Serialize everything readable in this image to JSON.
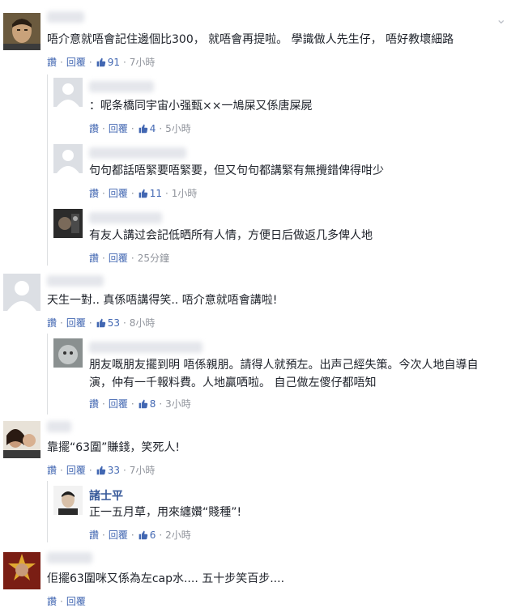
{
  "labels": {
    "like": "讚",
    "reply": "回覆"
  },
  "icons": {
    "like": "thumbs-up-icon",
    "more": "chevron-down-icon"
  },
  "colors": {
    "link": "#4267b2",
    "name": "#365899",
    "meta": "#90949c"
  },
  "comments": [
    {
      "id": "c1",
      "author": "",
      "text": "唔介意就唔會記住邊個比300， 就唔會再提啦。 學識做人先生仔， 唔好教壞細路",
      "likes": "91",
      "time": "7小時"
    },
    {
      "id": "r1",
      "author": "",
      "text": "：呢条橋同宇宙小强甄××一鳩屎又係唐屎屍",
      "likes": "4",
      "time": "5小時"
    },
    {
      "id": "r2",
      "author": "",
      "text": "句句都話唔緊要唔緊要，但又句句都講緊有無攪錯俾得咁少",
      "likes": "11",
      "time": "1小時"
    },
    {
      "id": "r3",
      "author": "",
      "text": "有友人講过会記低晒所有人情，方便日后做返几多俾人地",
      "likes": "",
      "time": "25分鐘"
    },
    {
      "id": "c2",
      "author": "",
      "text": "天生一對.. 真係唔講得笑.. 唔介意就唔會講啦!",
      "likes": "53",
      "time": "8小時"
    },
    {
      "id": "r4",
      "author": "",
      "text_line1": "朋友嘅朋友擺到明 唔係親朋。請得人就預左。出声己經失策。今次人地自導自",
      "text_line2": "演，仲有一千報料費。人地贏哂啦。 自己做左傻仔都唔知",
      "likes": "8",
      "time": "3小時"
    },
    {
      "id": "c3",
      "author": "",
      "text": "靠擺“63圍”賺錢，笑死人!",
      "likes": "33",
      "time": "7小時"
    },
    {
      "id": "r5",
      "author": "諸士平",
      "text": "正一五月草，用來纏㜺“賤種”!",
      "likes": "6",
      "time": "2小時"
    },
    {
      "id": "c4",
      "author": "",
      "text": "佢擺63圍咪又係為左cap水.... 五十步笑百步...."
    }
  ]
}
